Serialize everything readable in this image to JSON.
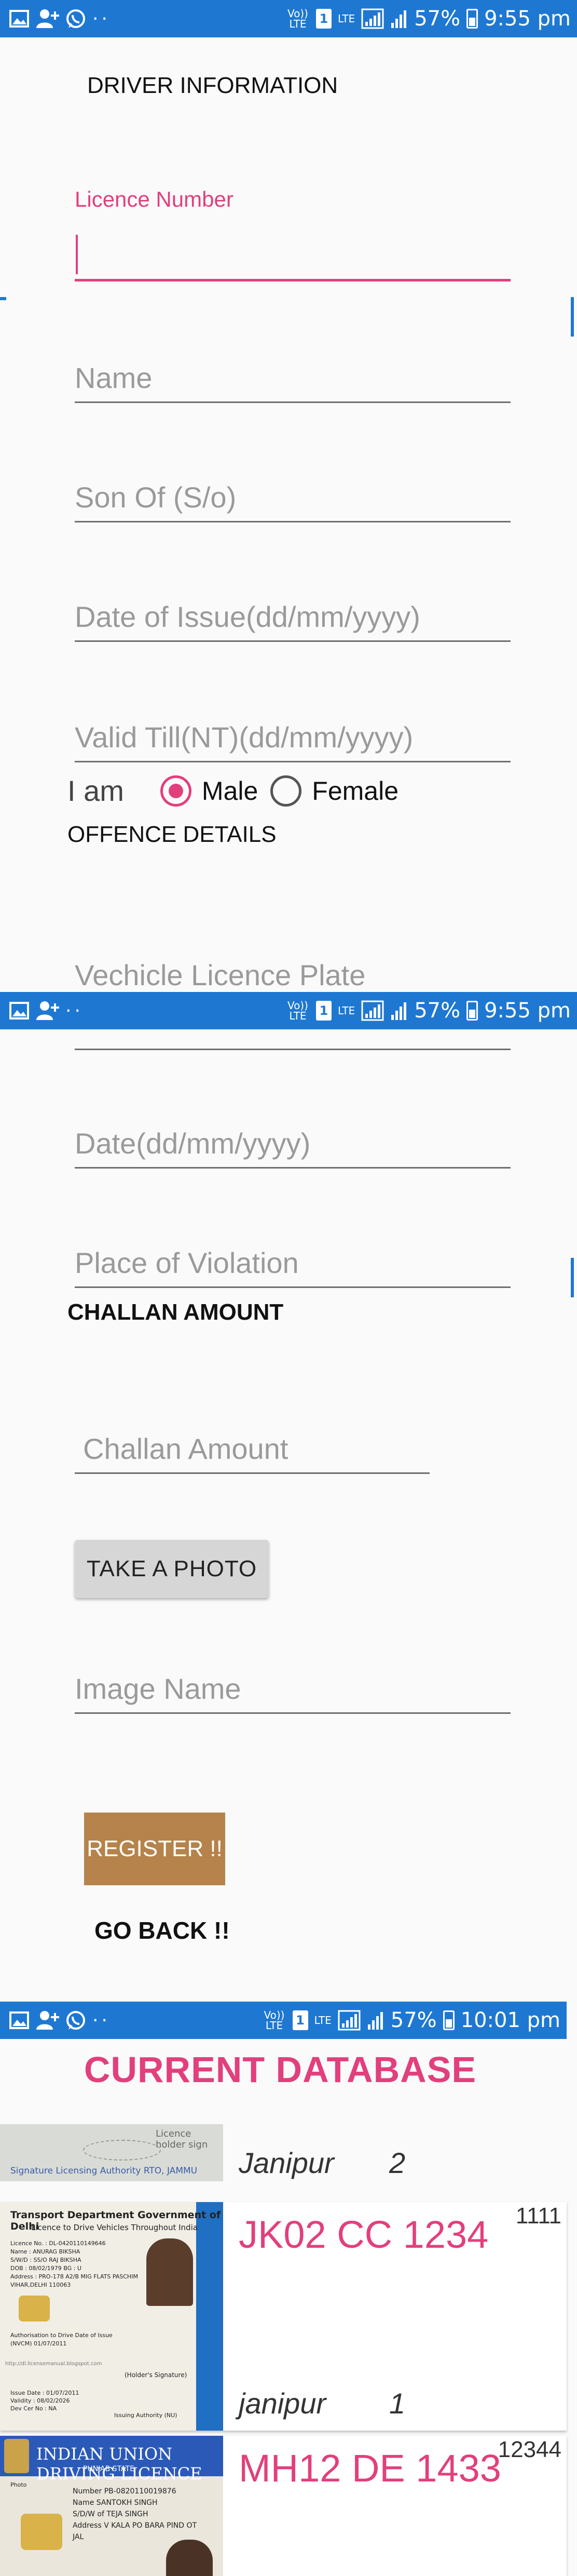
{
  "status_bars": [
    {
      "carrier": "Vo)) LTE",
      "sim": "1",
      "lte": "LTE",
      "battery": "57%",
      "time": "9:55 pm"
    },
    {
      "carrier": "Vo)) LTE",
      "sim": "1",
      "lte": "LTE",
      "battery": "57%",
      "time": "9:55 pm"
    },
    {
      "carrier": "Vo)) LTE",
      "sim": "1",
      "lte": "LTE",
      "battery": "57%",
      "time": "10:01 pm"
    }
  ],
  "driver": {
    "section_title": "DRIVER INFORMATION",
    "licence_label": "Licence Number",
    "licence_value": "",
    "name_placeholder": "Name",
    "son_of_placeholder": "Son Of (S/o)",
    "date_issue_placeholder": "Date of Issue(dd/mm/yyyy)",
    "valid_till_placeholder": "Valid Till(NT)(dd/mm/yyyy)",
    "gender_prompt": "I am",
    "gender_options": [
      "Male",
      "Female"
    ],
    "gender_selected": "Male"
  },
  "offence": {
    "section_title": "OFFENCE DETAILS",
    "plate_placeholder": "Vechicle Licence Plate",
    "date_placeholder": "Date(dd/mm/yyyy)",
    "place_placeholder": "Place of Violation"
  },
  "challan": {
    "section_title": "CHALLAN AMOUNT",
    "amount_placeholder": "Challan Amount",
    "photo_button": "TAKE A PHOTO",
    "image_name_placeholder": "Image Name",
    "register_button": "REGISTER !!",
    "go_back": "GO BACK !!"
  },
  "database": {
    "title": "CURRENT DATABASE",
    "records": [
      {
        "plate": "",
        "city": "Janipur",
        "number": "2",
        "code": "",
        "licence_text": "Signature Licensing Authority RTO, JAMMU",
        "licence_stamp": "Licence holder sign"
      },
      {
        "plate": "JK02 CC 1234",
        "city": "janipur",
        "number": "1",
        "code": "1111",
        "licence_header": "Transport Department Government of Delhi",
        "licence_sub": "Licence to Drive Vehicles Throughout India",
        "licence_lines": [
          "Licence No. : DL-0420110149646",
          "Name : ANURAG BIKSHA",
          "S/W/D : SS/O RAJ BIKSHA",
          "DOB : 08/02/1979  BG : U",
          "Address : PRO-178 A2/B MIG FLATS PASCHIM",
          "VIHAR,DELHI 110063"
        ],
        "licence_sig": "Authorisation to Drive  Date of Issue",
        "licence_cls": "(NVCM)  01/07/2011",
        "licence_footer": [
          "Issue Date : 01/07/2011",
          "Validity : 08/02/2026",
          "Dev Cer No : NA"
        ],
        "licence_holder": "(Holder's Signature)",
        "licence_auth": "Issuing Authority (NU)",
        "licence_url": "http://dl.licensemanual.blogspot.com"
      },
      {
        "plate": "MH12 DE 1433",
        "city": "",
        "number": "",
        "code": "12344",
        "licence_header": "INDIAN UNION DRIVING LICENCE",
        "licence_sub": "PUNJAB STATE",
        "licence_lines": [
          "Number PB-0820110019876",
          "Name SANTOKH SINGH",
          "S/D/W of TEJA SINGH",
          "Address V KALA PO BARA PIND OT",
          "JAL"
        ],
        "licence_photo_label": "Photo"
      }
    ]
  }
}
